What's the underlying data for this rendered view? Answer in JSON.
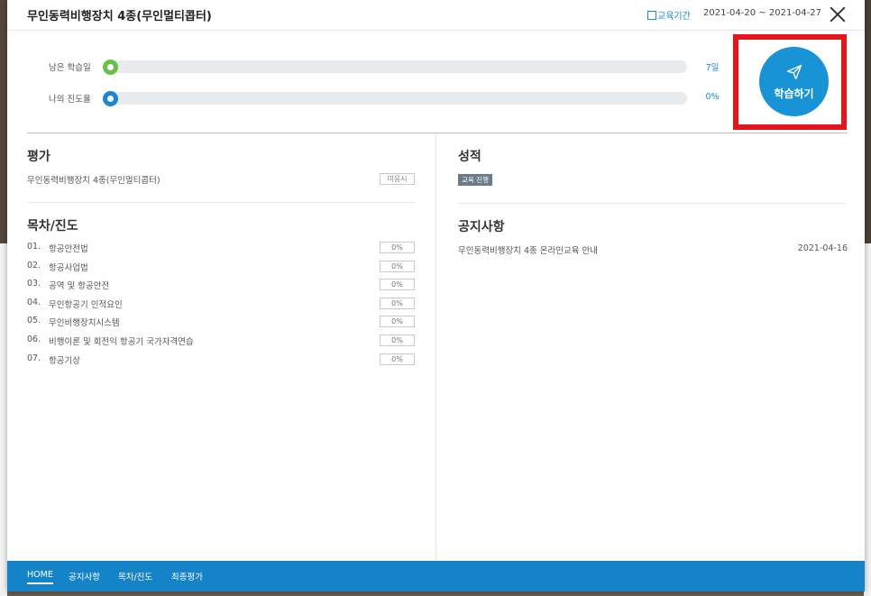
{
  "header": {
    "title": "무인동력비행장치 4종(무인멀티콥터)",
    "period_label": "교육기간",
    "period_dates": "2021-04-20 ~ 2021-04-27"
  },
  "progress": {
    "remaining": {
      "label": "남은 학습일",
      "value": "7일",
      "color": "#6abf4b",
      "fraction": 0
    },
    "mine": {
      "label": "나의 진도율",
      "value": "0%",
      "color": "#1a87d0",
      "fraction": 0
    }
  },
  "study_button": {
    "label": "학습하기"
  },
  "evaluation": {
    "title": "평가",
    "item": "무인동력비행장치 4종(무인멀티콥터)",
    "status": "미응시"
  },
  "grade": {
    "title": "성적",
    "badge": "교육 진행"
  },
  "toc": {
    "title": "목차/진도",
    "items": [
      {
        "num": "01.",
        "label": "항공안전법",
        "pct": "0%"
      },
      {
        "num": "02.",
        "label": "항공사업법",
        "pct": "0%"
      },
      {
        "num": "03.",
        "label": "공역 및 항공안전",
        "pct": "0%"
      },
      {
        "num": "04.",
        "label": "무인항공기 인적요인",
        "pct": "0%"
      },
      {
        "num": "05.",
        "label": "무인비행장치시스템",
        "pct": "0%"
      },
      {
        "num": "06.",
        "label": "비행이론 및 회전익 항공기 국가자격연습",
        "pct": "0%"
      },
      {
        "num": "07.",
        "label": "항공기상",
        "pct": "0%"
      }
    ]
  },
  "notice": {
    "title": "공지사항",
    "item": "무인동력비행장치 4종 온라인교육 안내",
    "date": "2021-04-16"
  },
  "footer": {
    "tabs": [
      "HOME",
      "공지사항",
      "목차/진도",
      "최종평가"
    ]
  },
  "colors": {
    "accent": "#1793d6",
    "highlight_border": "#e8141c",
    "footer_bg": "#1583c8"
  }
}
